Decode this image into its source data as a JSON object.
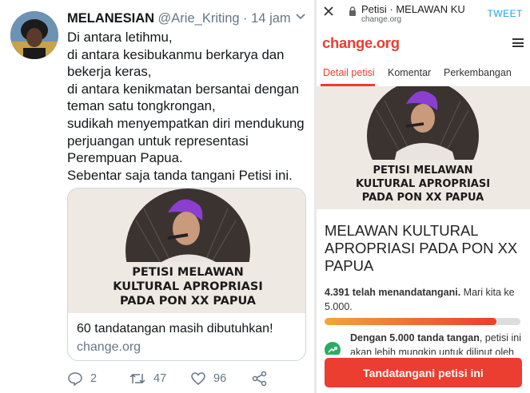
{
  "tweet": {
    "display_name": "MELANESIAN",
    "handle": "@Arie_Kriting",
    "time": "· 14 jam",
    "lines": [
      "Di antara letihmu,",
      "di antara kesibukanmu berkarya dan",
      "bekerja keras,",
      "di antara kenikmatan bersantai dengan",
      "teman satu tongkrongan,",
      "sudikah menyempatkan diri mendukung",
      "perjuangan untuk representasi",
      "Perempuan Papua.",
      "Sebentar saja tanda tangani Petisi ini."
    ],
    "card": {
      "image_text": [
        "PETISI MELAWAN",
        "KULTURAL APROPRIASI",
        "PADA PON XX PAPUA"
      ],
      "subtitle": "60 tandatangan masih dibutuhkan!",
      "domain": "change.org"
    },
    "actions": {
      "replies": "2",
      "retweets": "47",
      "likes": "96"
    }
  },
  "browser": {
    "title": "Petisi · MELAWAN KULT...",
    "url": "change.org",
    "tweet_label": "TWEET"
  },
  "site": {
    "logo": "change.org",
    "tabs": [
      "Detail petisi",
      "Komentar",
      "Perkembangan"
    ],
    "hero_text": [
      "PETISI MELAWAN",
      "KULTURAL APROPRIASI",
      "PADA PON XX PAPUA"
    ],
    "title_lines": [
      "MELAWAN KULTURAL",
      "APROPRIASI PADA PON XX",
      "PAPUA"
    ],
    "signed_bold": "4.391 telah menandatangani.",
    "signed_rest": " Mari kita ke",
    "signed_goal": "5.000.",
    "progress_fraction": 0.8782,
    "goal_bold": "Dengan 5.000 tanda tangan",
    "goal_rest": ", petisi ini",
    "goal_line2": "akan lebih mungkin untuk dilinut oleh",
    "sign_button": "Tandatangani petisi ini",
    "colors": {
      "brand": "#eb3d30",
      "accent_twitter": "#1da1f2"
    }
  }
}
